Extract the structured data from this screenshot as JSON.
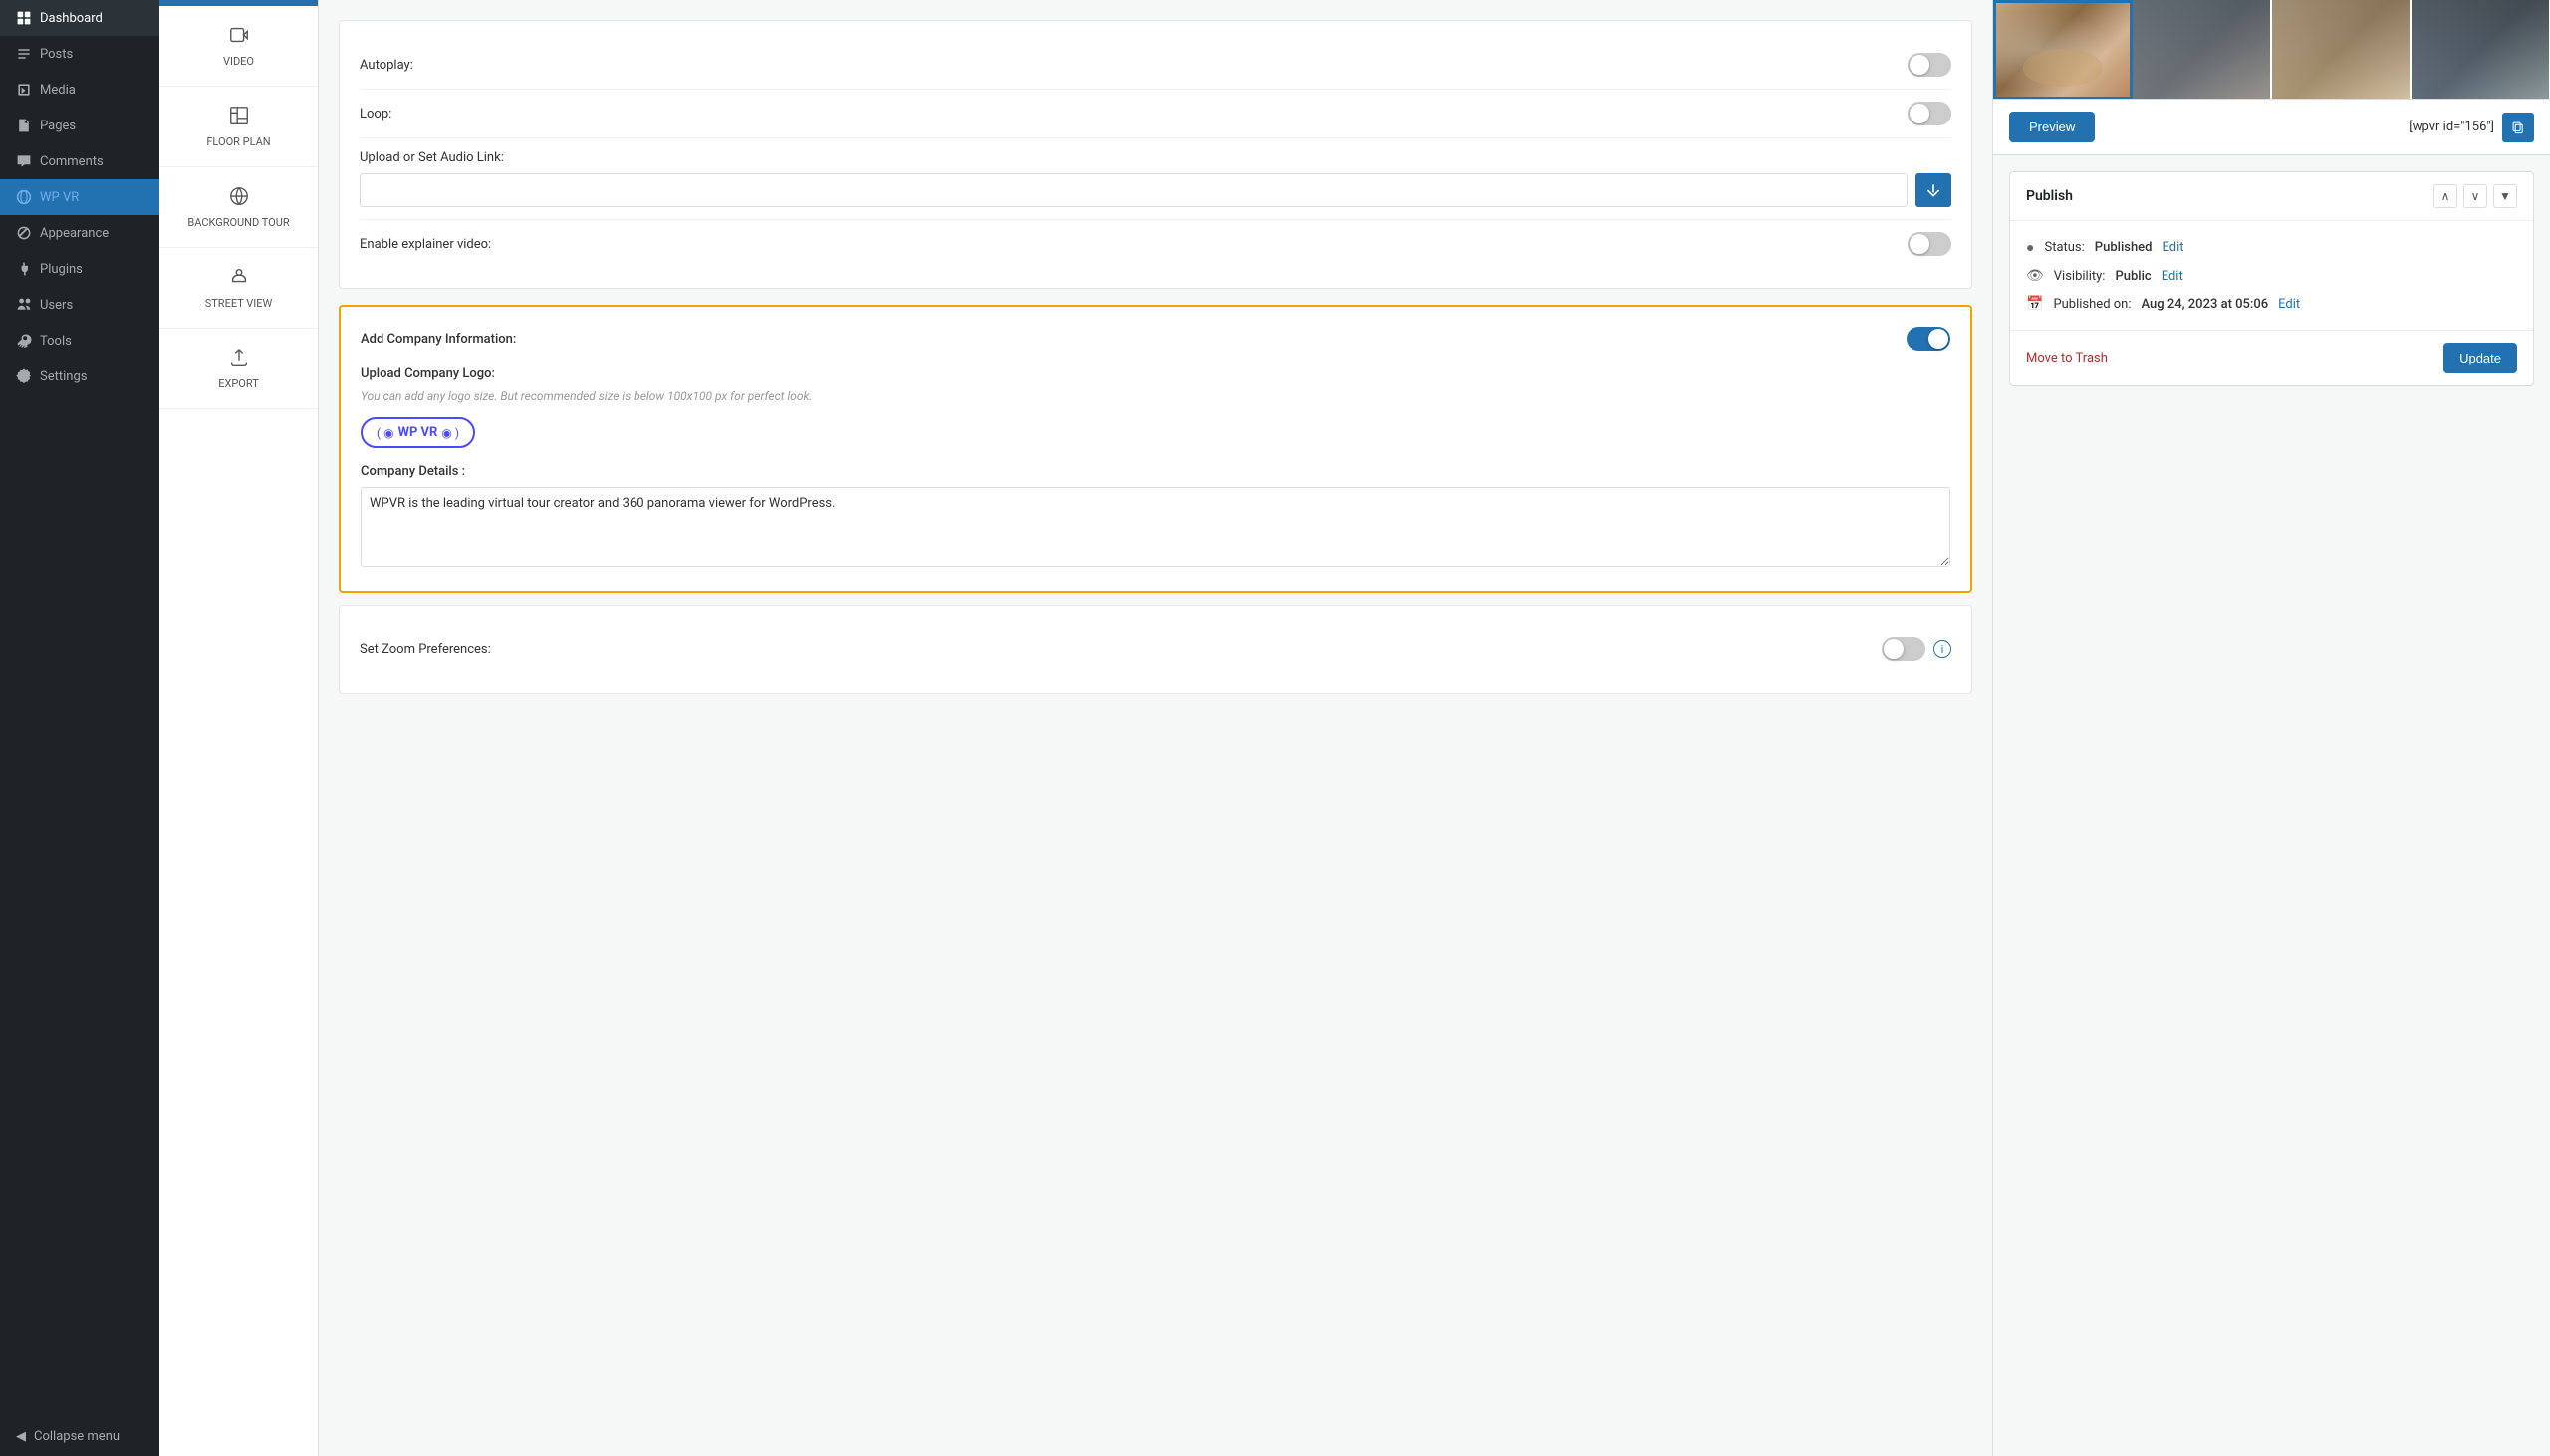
{
  "sidebar": {
    "items": [
      {
        "label": "Dashboard",
        "icon": "dashboard-icon",
        "active": false
      },
      {
        "label": "Posts",
        "icon": "posts-icon",
        "active": false
      },
      {
        "label": "Media",
        "icon": "media-icon",
        "active": false
      },
      {
        "label": "Pages",
        "icon": "pages-icon",
        "active": false
      },
      {
        "label": "Comments",
        "icon": "comments-icon",
        "active": false
      },
      {
        "label": "WP VR",
        "icon": "wpvr-icon",
        "active": true
      },
      {
        "label": "Appearance",
        "icon": "appearance-icon",
        "active": false
      },
      {
        "label": "Plugins",
        "icon": "plugins-icon",
        "active": false
      },
      {
        "label": "Users",
        "icon": "users-icon",
        "active": false
      },
      {
        "label": "Tools",
        "icon": "tools-icon",
        "active": false
      },
      {
        "label": "Settings",
        "icon": "settings-icon",
        "active": false
      }
    ],
    "collapse_label": "Collapse menu"
  },
  "left_nav": {
    "items": [
      {
        "label": "VIDEO",
        "icon": "video-icon"
      },
      {
        "label": "FLOOR PLAN",
        "icon": "floorplan-icon"
      },
      {
        "label": "BACKGROUND TOUR",
        "icon": "background-icon"
      },
      {
        "label": "STREET VIEW",
        "icon": "streetview-icon"
      },
      {
        "label": "EXPORT",
        "icon": "export-icon"
      }
    ]
  },
  "settings": {
    "autoplay_label": "Autoplay:",
    "autoplay_on": false,
    "loop_label": "Loop:",
    "loop_on": false,
    "audio_link_label": "Upload or Set Audio Link:",
    "audio_link_value": "",
    "audio_link_placeholder": "",
    "explainer_label": "Enable explainer video:",
    "explainer_on": false,
    "company_info": {
      "title": "Add Company Information:",
      "toggle_on": true,
      "upload_logo_label": "Upload Company Logo:",
      "upload_logo_hint": "You can add any logo size. But recommended size is below 100x100 px for perfect look.",
      "logo_text": "WP VR",
      "company_details_label": "Company Details :",
      "company_details_value": "WPVR is the leading virtual tour creator and 360 panorama viewer for WordPress."
    },
    "zoom_label": "Set Zoom Preferences:"
  },
  "preview": {
    "preview_btn_label": "Preview",
    "shortcode_text": "[wpvr id=\"156\"]",
    "copy_icon": "copy-icon"
  },
  "publish": {
    "title": "Publish",
    "status_label": "Status:",
    "status_value": "Published",
    "status_edit": "Edit",
    "visibility_label": "Visibility:",
    "visibility_value": "Public",
    "visibility_edit": "Edit",
    "published_label": "Published on:",
    "published_value": "Aug 24, 2023 at 05:06",
    "published_edit": "Edit",
    "move_trash": "Move to Trash",
    "update_btn": "Update"
  },
  "colors": {
    "blue": "#2271b1",
    "orange": "#f0a500",
    "sidebar_bg": "#1d2327",
    "active_blue": "#2271b1"
  }
}
